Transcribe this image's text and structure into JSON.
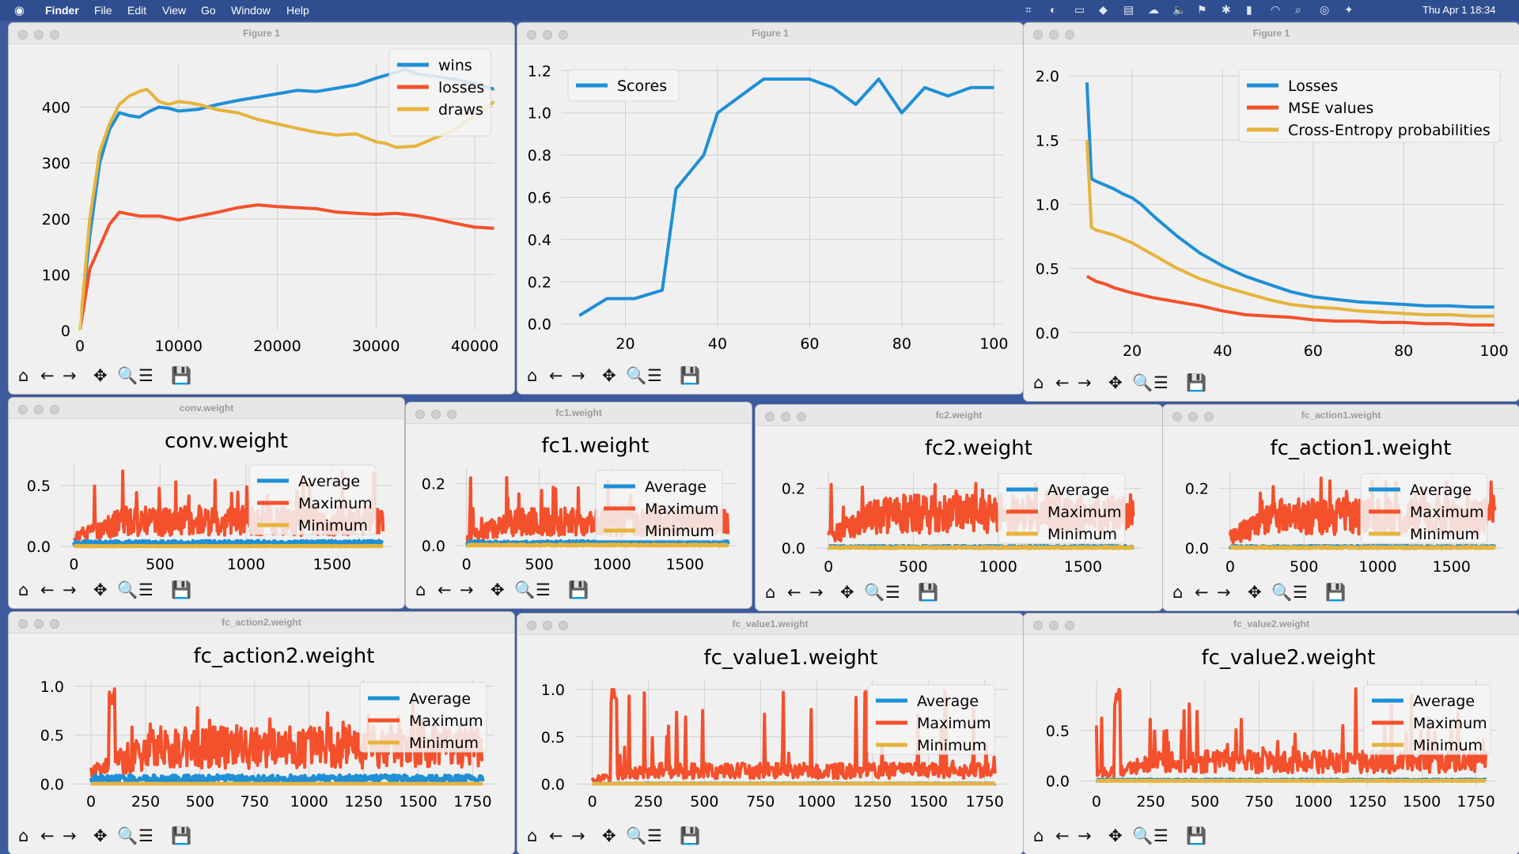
{
  "menubar": {
    "apple_icon": "apple-icon",
    "app_name": "Finder",
    "items": [
      "File",
      "Edit",
      "View",
      "Go",
      "Window",
      "Help"
    ],
    "clock": "Thu Apr 1  18:34",
    "status_icons": [
      "screen-capture-icon",
      "chrome-icon",
      "window-icon",
      "docker-icon",
      "stack-icon",
      "cloud-icon",
      "volume-icon",
      "flag-icon",
      "bluetooth-icon",
      "battery-icon",
      "wifi-icon",
      "search-icon",
      "control-center-icon",
      "siri-icon"
    ]
  },
  "toolbar_icons": [
    "home-icon",
    "back-icon",
    "forward-icon",
    "pan-icon",
    "zoom-icon",
    "configure-icon",
    "save-icon"
  ],
  "colors": {
    "blue": "#1f8fd6",
    "red": "#f4502c",
    "yellow": "#e6b43c",
    "grid": "#d0d0d0"
  },
  "windows": [
    {
      "title": "Figure 1",
      "chart_data": {
        "type": "line",
        "series": [
          {
            "name": "wins",
            "color": "#1f8fd6",
            "x": [
              0,
              1000,
              2000,
              3000,
              4000,
              5000,
              6000,
              7000,
              8000,
              9000,
              10000,
              12000,
              14000,
              16000,
              18000,
              20000,
              22000,
              24000,
              26000,
              28000,
              30000,
              32000,
              33000,
              34000,
              36000,
              38000,
              40000,
              42000
            ],
            "values": [
              0,
              170,
              300,
              360,
              390,
              385,
              382,
              392,
              400,
              398,
              393,
              396,
              405,
              412,
              418,
              424,
              430,
              428,
              434,
              440,
              452,
              462,
              468,
              460,
              455,
              450,
              442,
              432
            ]
          },
          {
            "name": "losses",
            "color": "#f4502c",
            "x": [
              0,
              1000,
              2000,
              3000,
              4000,
              6000,
              8000,
              10000,
              12000,
              14000,
              16000,
              18000,
              20000,
              22000,
              24000,
              26000,
              28000,
              30000,
              32000,
              34000,
              36000,
              38000,
              40000,
              42000
            ],
            "values": [
              0,
              110,
              150,
              190,
              212,
              205,
              205,
              198,
              205,
              212,
              220,
              225,
              222,
              220,
              218,
              212,
              210,
              208,
              210,
              206,
              200,
              192,
              185,
              183
            ]
          },
          {
            "name": "draws",
            "color": "#e6b43c",
            "x": [
              0,
              1000,
              2000,
              3000,
              4000,
              5000,
              6000,
              6800,
              8000,
              9000,
              10000,
              11000,
              12000,
              14000,
              16000,
              18000,
              20000,
              22000,
              24000,
              26000,
              28000,
              30000,
              31000,
              32000,
              34000,
              36000,
              38000,
              40000,
              42000
            ],
            "values": [
              0,
              200,
              320,
              370,
              405,
              420,
              428,
              432,
              410,
              405,
              410,
              408,
              405,
              395,
              390,
              378,
              370,
              362,
              355,
              350,
              352,
              338,
              335,
              328,
              330,
              345,
              360,
              385,
              410
            ]
          }
        ],
        "xlim": [
          0,
          42000
        ],
        "ylim": [
          0,
          480
        ],
        "xticks": [
          0,
          10000,
          20000,
          30000,
          40000
        ],
        "yticks": [
          0,
          100,
          200,
          300,
          400
        ],
        "grid": true,
        "legend": "top-right"
      }
    },
    {
      "title": "Figure 1",
      "chart_data": {
        "type": "line",
        "series": [
          {
            "name": "Scores",
            "color": "#1f8fd6",
            "x": [
              10,
              13,
              16,
              19,
              22,
              25,
              28,
              31,
              34,
              37,
              40,
              45,
              50,
              55,
              60,
              65,
              70,
              75,
              80,
              85,
              90,
              95,
              100
            ],
            "values": [
              0.04,
              0.08,
              0.12,
              0.12,
              0.12,
              0.14,
              0.16,
              0.64,
              0.72,
              0.8,
              1.0,
              1.08,
              1.16,
              1.16,
              1.16,
              1.12,
              1.04,
              1.16,
              1.0,
              1.12,
              1.08,
              1.12,
              1.12
            ]
          }
        ],
        "xlim": [
          6,
          102
        ],
        "ylim": [
          -0.02,
          1.22
        ],
        "xticks": [
          20,
          40,
          60,
          80,
          100
        ],
        "yticks": [
          0.0,
          0.2,
          0.4,
          0.6,
          0.8,
          1.0,
          1.2
        ],
        "grid": true,
        "legend": "top-left"
      }
    },
    {
      "title": "Figure 1",
      "chart_data": {
        "type": "line",
        "series": [
          {
            "name": "Losses",
            "color": "#1f8fd6",
            "x": [
              10,
              11,
              12,
              14,
              16,
              18,
              20,
              22,
              25,
              30,
              35,
              40,
              45,
              50,
              55,
              60,
              65,
              70,
              75,
              80,
              85,
              90,
              95,
              100
            ],
            "values": [
              1.95,
              1.2,
              1.18,
              1.15,
              1.12,
              1.08,
              1.05,
              1.0,
              0.9,
              0.75,
              0.62,
              0.52,
              0.44,
              0.38,
              0.32,
              0.28,
              0.26,
              0.24,
              0.23,
              0.22,
              0.21,
              0.21,
              0.2,
              0.2
            ]
          },
          {
            "name": "MSE values",
            "color": "#f4502c",
            "x": [
              10,
              12,
              14,
              16,
              18,
              20,
              25,
              30,
              35,
              40,
              45,
              50,
              55,
              60,
              65,
              70,
              75,
              80,
              85,
              90,
              95,
              100
            ],
            "values": [
              0.44,
              0.4,
              0.38,
              0.35,
              0.33,
              0.31,
              0.27,
              0.24,
              0.21,
              0.17,
              0.14,
              0.13,
              0.12,
              0.1,
              0.09,
              0.09,
              0.08,
              0.08,
              0.07,
              0.07,
              0.06,
              0.06
            ]
          },
          {
            "name": "Cross-Entropy probabilities",
            "color": "#e6b43c",
            "x": [
              10,
              11,
              12,
              14,
              16,
              18,
              20,
              22,
              25,
              30,
              35,
              40,
              45,
              50,
              55,
              60,
              65,
              70,
              75,
              80,
              85,
              90,
              95,
              100
            ],
            "values": [
              1.5,
              0.82,
              0.8,
              0.78,
              0.76,
              0.73,
              0.7,
              0.66,
              0.6,
              0.5,
              0.42,
              0.36,
              0.31,
              0.26,
              0.22,
              0.2,
              0.19,
              0.17,
              0.16,
              0.15,
              0.14,
              0.14,
              0.13,
              0.13
            ]
          }
        ],
        "xlim": [
          6,
          102
        ],
        "ylim": [
          -0.02,
          2.05
        ],
        "xticks": [
          20,
          40,
          60,
          80,
          100
        ],
        "yticks": [
          0.0,
          0.5,
          1.0,
          1.5,
          2.0
        ],
        "grid": true,
        "legend": "top-right"
      }
    },
    {
      "title": "conv.weight",
      "chart_data": {
        "type": "line",
        "title": "conv.weight",
        "series": [
          {
            "name": "Average",
            "color": "#1f8fd6",
            "level": 0.03
          },
          {
            "name": "Maximum",
            "color": "#f4502c",
            "level": 0.22,
            "peak": 0.62
          },
          {
            "name": "Minimum",
            "color": "#e6b43c",
            "level": 0.0
          }
        ],
        "n": 1800,
        "xlim": [
          -80,
          1850
        ],
        "ylim": [
          -0.02,
          0.68
        ],
        "xticks": [
          0,
          500,
          1000,
          1500
        ],
        "yticks": [
          0.0,
          0.5
        ],
        "grid": true,
        "legend": "right"
      }
    },
    {
      "title": "fc1.weight",
      "chart_data": {
        "type": "line",
        "title": "fc1.weight",
        "series": [
          {
            "name": "Average",
            "color": "#1f8fd6",
            "level": 0.01
          },
          {
            "name": "Maximum",
            "color": "#f4502c",
            "level": 0.08,
            "peak": 0.22
          },
          {
            "name": "Minimum",
            "color": "#e6b43c",
            "level": 0.0
          }
        ],
        "n": 1800,
        "xlim": [
          -80,
          1850
        ],
        "ylim": [
          -0.01,
          0.25
        ],
        "xticks": [
          0,
          500,
          1000,
          1500
        ],
        "yticks": [
          0.0,
          0.2
        ],
        "grid": true,
        "legend": "right"
      }
    },
    {
      "title": "fc2.weight",
      "chart_data": {
        "type": "line",
        "title": "fc2.weight",
        "series": [
          {
            "name": "Average",
            "color": "#1f8fd6",
            "level": 0.005
          },
          {
            "name": "Maximum",
            "color": "#f4502c",
            "level": 0.12,
            "peak": 0.22
          },
          {
            "name": "Minimum",
            "color": "#e6b43c",
            "level": 0.0
          }
        ],
        "n": 1800,
        "xlim": [
          -80,
          1850
        ],
        "ylim": [
          -0.01,
          0.26
        ],
        "xticks": [
          0,
          500,
          1000,
          1500
        ],
        "yticks": [
          0.0,
          0.2
        ],
        "grid": true,
        "legend": "right"
      }
    },
    {
      "title": "fc_action1.weight",
      "chart_data": {
        "type": "line",
        "title": "fc_action1.weight",
        "series": [
          {
            "name": "Average",
            "color": "#1f8fd6",
            "level": 0.005
          },
          {
            "name": "Maximum",
            "color": "#f4502c",
            "level": 0.11,
            "peak": 0.24
          },
          {
            "name": "Minimum",
            "color": "#e6b43c",
            "level": 0.0
          }
        ],
        "n": 1800,
        "xlim": [
          -80,
          1850
        ],
        "ylim": [
          -0.01,
          0.26
        ],
        "xticks": [
          0,
          500,
          1000,
          1500
        ],
        "yticks": [
          0.0,
          0.2
        ],
        "grid": true,
        "legend": "right"
      }
    },
    {
      "title": "fc_action2.weight",
      "chart_data": {
        "type": "line",
        "title": "fc_action2.weight",
        "series": [
          {
            "name": "Average",
            "color": "#1f8fd6",
            "level": 0.06
          },
          {
            "name": "Maximum",
            "color": "#f4502c",
            "level": 0.4,
            "peak": 1.0
          },
          {
            "name": "Minimum",
            "color": "#e6b43c",
            "level": 0.0
          }
        ],
        "n": 1800,
        "xlim": [
          -80,
          1850
        ],
        "ylim": [
          -0.02,
          1.08
        ],
        "xticks": [
          0,
          250,
          500,
          750,
          1000,
          1250,
          1500,
          1750
        ],
        "yticks": [
          0.0,
          0.5,
          1.0
        ],
        "grid": true,
        "legend": "right"
      }
    },
    {
      "title": "fc_value1.weight",
      "chart_data": {
        "type": "line",
        "title": "fc_value1.weight",
        "series": [
          {
            "name": "Average",
            "color": "#1f8fd6",
            "level": 0.005
          },
          {
            "name": "Maximum",
            "color": "#f4502c",
            "level": 0.15,
            "peak": 1.02
          },
          {
            "name": "Minimum",
            "color": "#e6b43c",
            "level": 0.0
          }
        ],
        "n": 1800,
        "xlim": [
          -80,
          1850
        ],
        "ylim": [
          -0.02,
          1.1
        ],
        "xticks": [
          0,
          250,
          500,
          750,
          1000,
          1250,
          1500,
          1750
        ],
        "yticks": [
          0.0,
          0.5,
          1.0
        ],
        "grid": true,
        "legend": "right"
      }
    },
    {
      "title": "fc_value2.weight",
      "chart_data": {
        "type": "line",
        "title": "fc_value2.weight",
        "series": [
          {
            "name": "Average",
            "color": "#1f8fd6",
            "level": 0.01
          },
          {
            "name": "Maximum",
            "color": "#f4502c",
            "level": 0.2,
            "peak": 0.92
          },
          {
            "name": "Minimum",
            "color": "#e6b43c",
            "level": 0.0
          }
        ],
        "n": 1800,
        "xlim": [
          -80,
          1850
        ],
        "ylim": [
          -0.05,
          1.0
        ],
        "xticks": [
          0,
          250,
          500,
          750,
          1000,
          1250,
          1500,
          1750
        ],
        "yticks": [
          0.0,
          0.5
        ],
        "grid": true,
        "legend": "right"
      }
    }
  ]
}
